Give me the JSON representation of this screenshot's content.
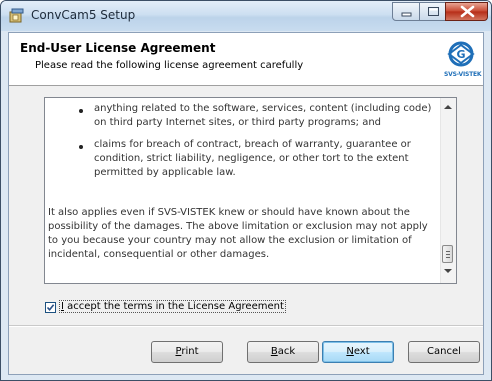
{
  "window": {
    "title": "ConvCam5 Setup",
    "controls": [
      "minimize-icon",
      "maximize-icon",
      "close-icon"
    ]
  },
  "header": {
    "title": "End-User License Agreement",
    "subtitle": "Please read the following license agreement carefully",
    "logo_text": "SVS-VISTEK"
  },
  "license": {
    "bullets": [
      "anything related to the software, services, content (including code) on third party Internet sites, or third party programs; and",
      "claims for breach of contract, breach of warranty, guarantee or condition, strict liability, negligence, or other tort to the extent permitted by applicable law."
    ],
    "paragraph": "It also applies even if SVS-VISTEK knew or should have known about the possibility of the damages. The above limitation or exclusion may not apply to you because your country may not allow the exclusion or limitation of incidental, consequential or other damages."
  },
  "accept": {
    "checked": true,
    "label_first": "I",
    "label_rest": " accept the terms in the License Agreement"
  },
  "buttons": {
    "print_u": "P",
    "print_rest": "rint",
    "back_u": "B",
    "back_rest": "ack",
    "next_u": "N",
    "next_rest": "ext",
    "cancel": "Cancel"
  },
  "colors": {
    "accent": "#1f6fb8",
    "titlebar": "#cddff1",
    "close_button": "#c7462f"
  }
}
